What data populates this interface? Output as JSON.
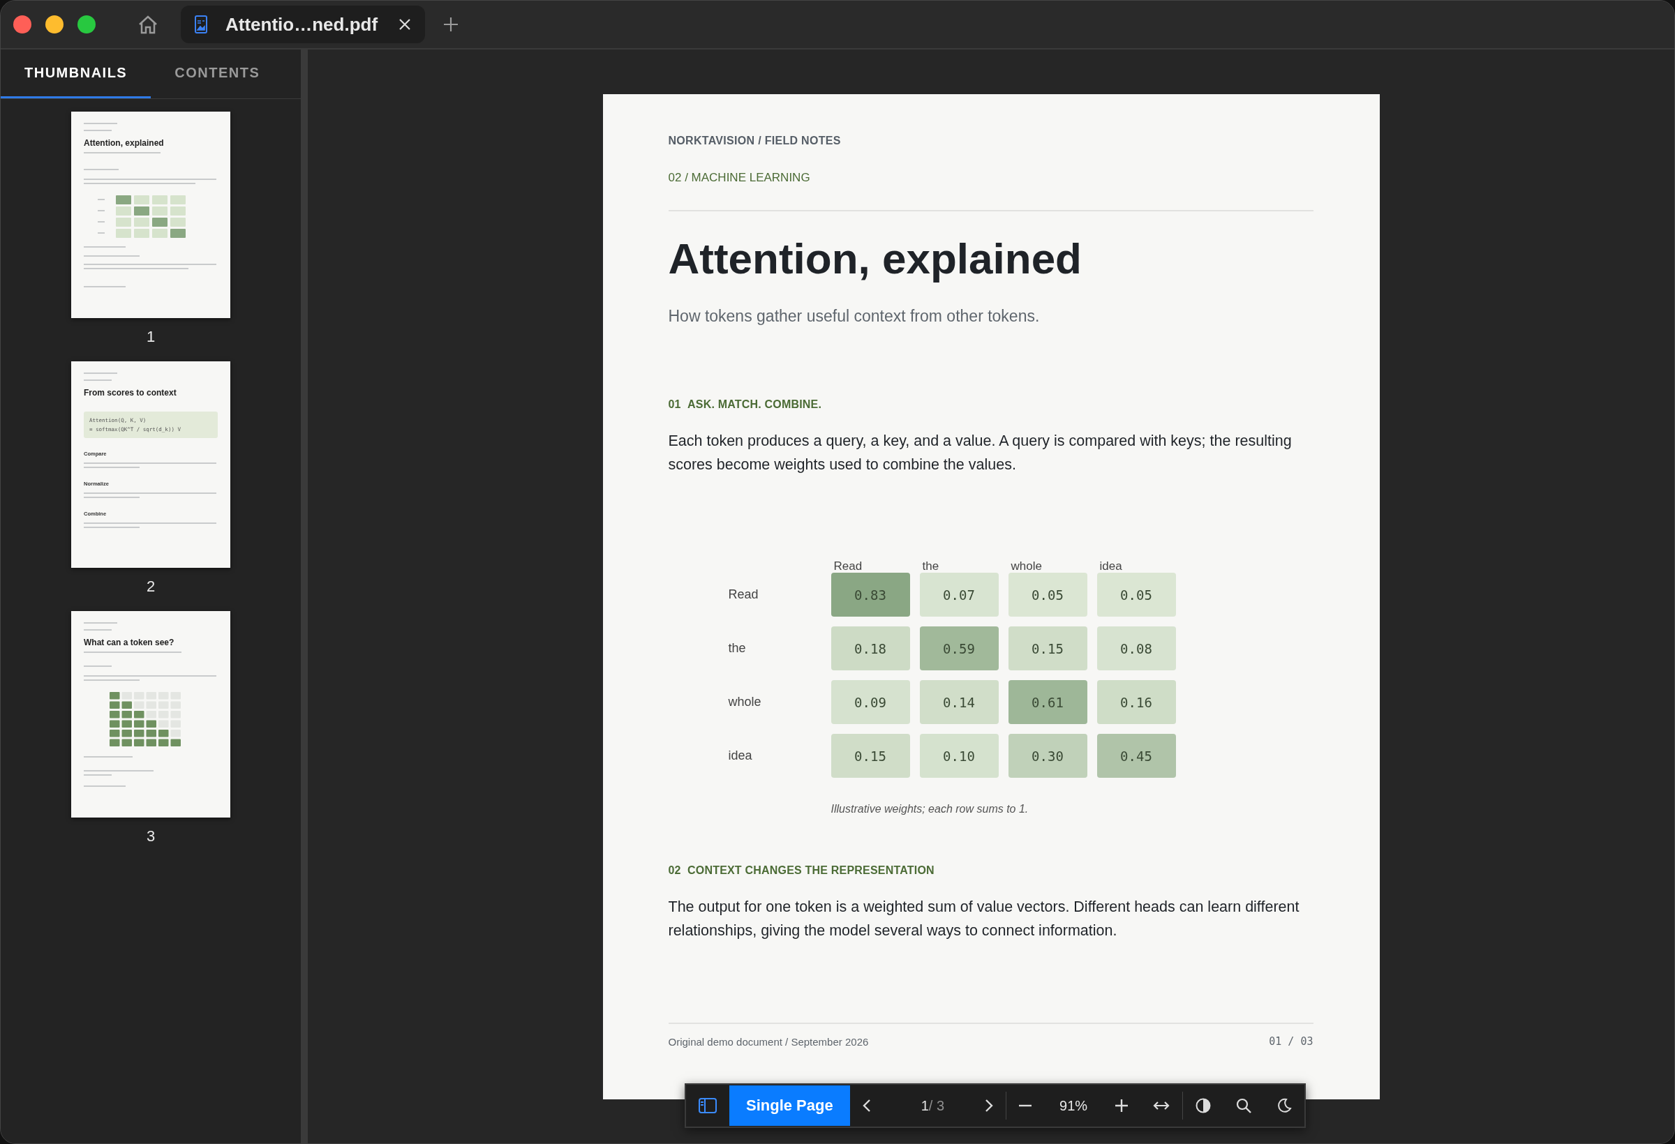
{
  "tab": {
    "title": "Attentio…ned.pdf"
  },
  "sidebar": {
    "tabs": [
      {
        "label": "THUMBNAILS",
        "selected": true
      },
      {
        "label": "CONTENTS",
        "selected": false
      }
    ],
    "thumbnails": [
      {
        "page": "1",
        "kind": "heatmap",
        "title": "Attention, explained"
      },
      {
        "page": "2",
        "kind": "formula",
        "title": "From scores to context",
        "code": [
          "Attention(Q, K, V)",
          "= softmax(QK^T / sqrt(d_k)) V"
        ],
        "headings": [
          "Compare",
          "Normalize",
          "Combine"
        ]
      },
      {
        "page": "3",
        "kind": "mask",
        "title": "What can a token see?"
      }
    ]
  },
  "document": {
    "header": "NORKTAVISION / FIELD NOTES",
    "category": "02 / MACHINE LEARNING",
    "title": "Attention, explained",
    "subtitle": "How tokens gather useful context from other tokens.",
    "sections": [
      {
        "number": "01",
        "heading": "ASK. MATCH. COMBINE.",
        "body": "Each token produces a query, a key, and a value. A query is compared with keys; the resulting scores become weights used to combine the values.",
        "heatmap": {
          "columns": [
            "Read",
            "the",
            "whole",
            "idea"
          ],
          "rows": [
            {
              "label": "Read",
              "values": [
                "0.83",
                "0.07",
                "0.05",
                "0.05"
              ]
            },
            {
              "label": "the",
              "values": [
                "0.18",
                "0.59",
                "0.15",
                "0.08"
              ]
            },
            {
              "label": "whole",
              "values": [
                "0.09",
                "0.14",
                "0.61",
                "0.16"
              ]
            },
            {
              "label": "idea",
              "values": [
                "0.15",
                "0.10",
                "0.30",
                "0.45"
              ]
            }
          ],
          "caption": "Illustrative weights; each row sums to 1."
        }
      },
      {
        "number": "02",
        "heading": "CONTEXT CHANGES THE REPRESENTATION",
        "body": "The output for one token is a weighted sum of value vectors. Different heads can learn different relationships, giving the model several ways to connect information."
      }
    ],
    "footer": {
      "left": "Original demo document / September 2026",
      "right": "01 / 03"
    }
  },
  "toolbar": {
    "sidebar_open": true,
    "view_mode": "Single Page",
    "page": "1",
    "page_total": "/ 3",
    "zoom": "91%"
  }
}
